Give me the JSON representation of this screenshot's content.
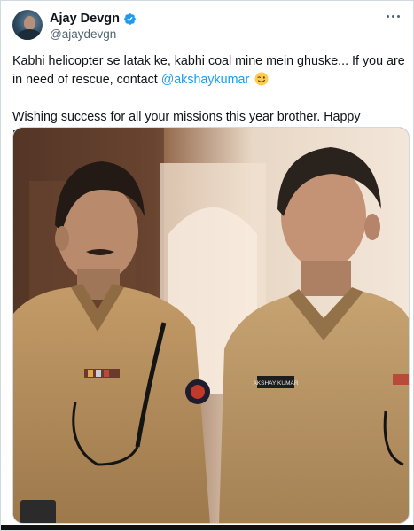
{
  "author": {
    "display_name": "Ajay Devgn",
    "handle": "@ajaydevgn",
    "verified_icon": "verified-badge-icon",
    "avatar_icon": "profile-photo"
  },
  "menu": {
    "icon": "more-options-icon"
  },
  "tweet": {
    "line1_before": "Kabhi helicopter se latak ke, kabhi coal mine mein ghuske... If you are in need of rescue, contact ",
    "mention": "@akshaykumar",
    "emoji": "winking-face-icon",
    "line2": "Wishing success for all your missions this year brother. Happy Birthday!"
  },
  "media": {
    "type": "photo",
    "description_icon": "police-officers-photo",
    "name_tag": "AKSHAY KUMAR"
  },
  "colors": {
    "accent": "#1d9bf0",
    "text": "#0f1419",
    "secondary": "#536471",
    "khaki": "#b28d5c"
  }
}
